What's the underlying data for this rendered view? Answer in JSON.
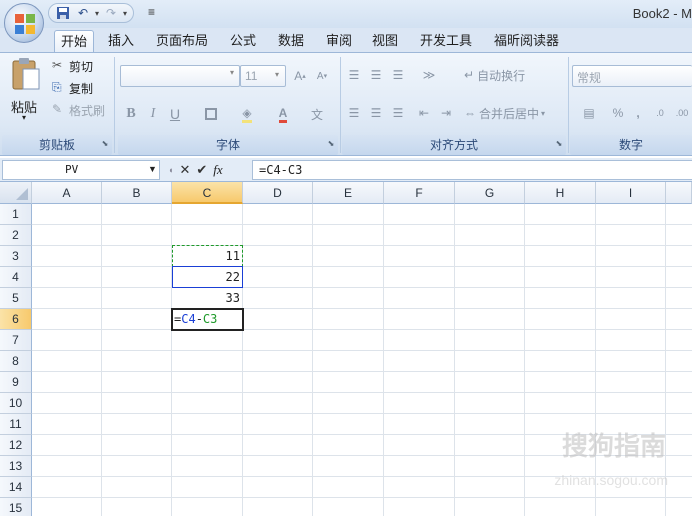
{
  "window": {
    "title": "Book2 - M"
  },
  "qat": {
    "customize_glyph": "≡"
  },
  "tabs": [
    {
      "label": "开始",
      "active": true
    },
    {
      "label": "插入"
    },
    {
      "label": "页面布局"
    },
    {
      "label": "公式"
    },
    {
      "label": "数据"
    },
    {
      "label": "审阅"
    },
    {
      "label": "视图"
    },
    {
      "label": "开发工具"
    },
    {
      "label": "福昕阅读器"
    }
  ],
  "ribbon": {
    "clipboard": {
      "paste": "粘贴",
      "cut": "剪切",
      "copy": "复制",
      "format_painter": "格式刷",
      "label": "剪贴板"
    },
    "font": {
      "size": "11",
      "bold": "B",
      "italic": "I",
      "underline": "U",
      "label": "字体"
    },
    "alignment": {
      "wrap_text": "自动换行",
      "merge_center": "合并后居中",
      "label": "对齐方式"
    },
    "number": {
      "format": "常规",
      "percent": "%",
      "comma": ",",
      "label": "数字"
    }
  },
  "formula_bar": {
    "name_box": "PV",
    "formula": "=C4-C3",
    "fx": "fx"
  },
  "columns": [
    "A",
    "B",
    "C",
    "D",
    "E",
    "F",
    "G",
    "H",
    "I"
  ],
  "rows": [
    "1",
    "2",
    "3",
    "4",
    "5",
    "6",
    "7",
    "8",
    "9",
    "10",
    "11",
    "12",
    "13",
    "14",
    "15"
  ],
  "cells": {
    "C3": "11",
    "C4": "22",
    "C5": "33",
    "C6_eq": "=",
    "C6_ref1": "C4",
    "C6_op": "-",
    "C6_ref2": "C3"
  },
  "colors": {
    "ref1": "#1a3fd6",
    "ref2": "#1f9a2a",
    "selection": "#e5a630"
  },
  "watermark": {
    "text": "搜狗指南",
    "url": "zhinan.sogou.com"
  }
}
